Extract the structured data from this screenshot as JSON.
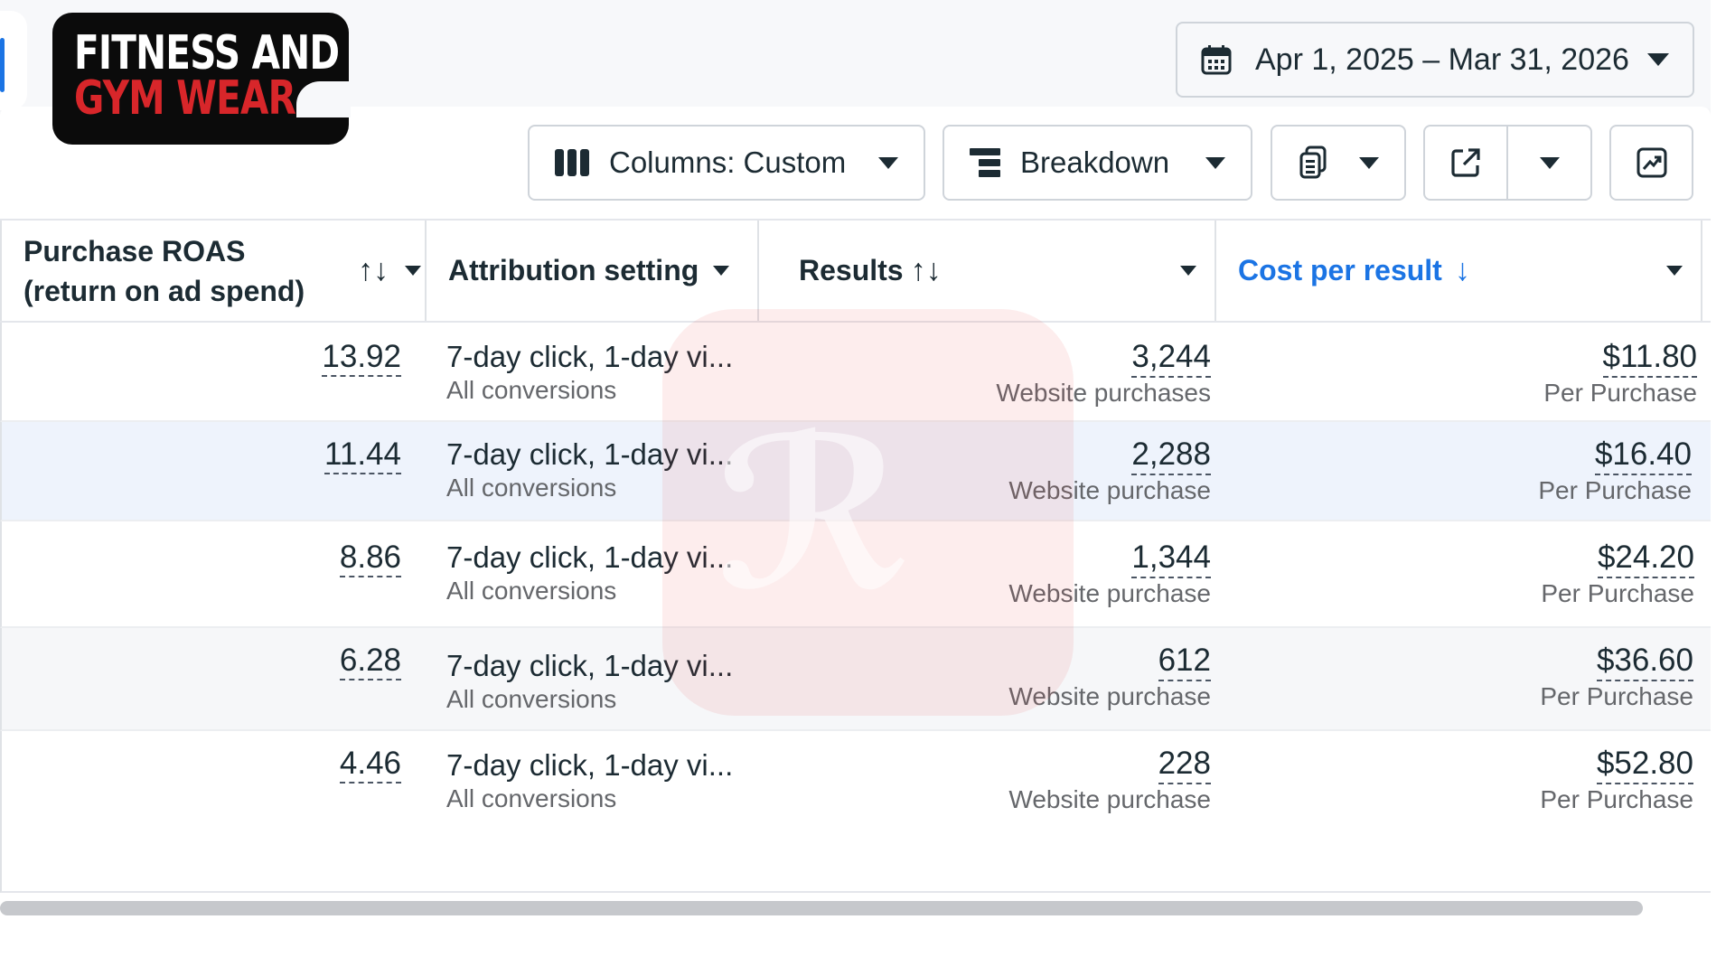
{
  "logo": {
    "line1": "FITNESS AND",
    "line2": "GYM WEAR"
  },
  "date_range": {
    "label": "Apr 1, 2025 – Mar 31, 2026",
    "icon": "calendar-icon"
  },
  "toolbar": {
    "columns_label": "Columns: Custom",
    "breakdown_label": "Breakdown",
    "reports_icon": "reports-icon",
    "export_icon": "export-icon",
    "chart_icon": "chart-icon"
  },
  "table": {
    "headers": {
      "roas_line1": "Purchase ROAS",
      "roas_line2": "(return on ad spend)",
      "attribution": "Attribution setting",
      "results": "Results",
      "cost": "Cost per result"
    },
    "rows": [
      {
        "roas": "13.92",
        "attr": "7-day click, 1-day vi...",
        "attr_sub": "All conversions",
        "results": "3,244",
        "results_sub": "Website purchases",
        "cost": "$11.80",
        "cost_sub": "Per Purchase"
      },
      {
        "roas": "11.44",
        "attr": "7-day click, 1-day vi...",
        "attr_sub": "All conversions",
        "results": "2,288",
        "results_sub": "Website purchase",
        "cost": "$16.40",
        "cost_sub": "Per Purchase"
      },
      {
        "roas": "8.86",
        "attr": "7-day click, 1-day vi...",
        "attr_sub": "All conversions",
        "results": "1,344",
        "results_sub": "Website purchase",
        "cost": "$24.20",
        "cost_sub": "Per Purchase"
      },
      {
        "roas": "6.28",
        "attr": "7-day click, 1-day vi...",
        "attr_sub": "All conversions",
        "results": "612",
        "results_sub": "Website purchase",
        "cost": "$36.60",
        "cost_sub": "Per Purchase"
      },
      {
        "roas": "4.46",
        "attr": "7-day click, 1-day vi...",
        "attr_sub": "All conversions",
        "results": "228",
        "results_sub": "Website purchase",
        "cost": "$52.80",
        "cost_sub": "Per Purchase"
      }
    ]
  },
  "colors": {
    "accent": "#1b74e4",
    "logo_red": "#d8262a",
    "row_highlight": "#eef3fc"
  }
}
